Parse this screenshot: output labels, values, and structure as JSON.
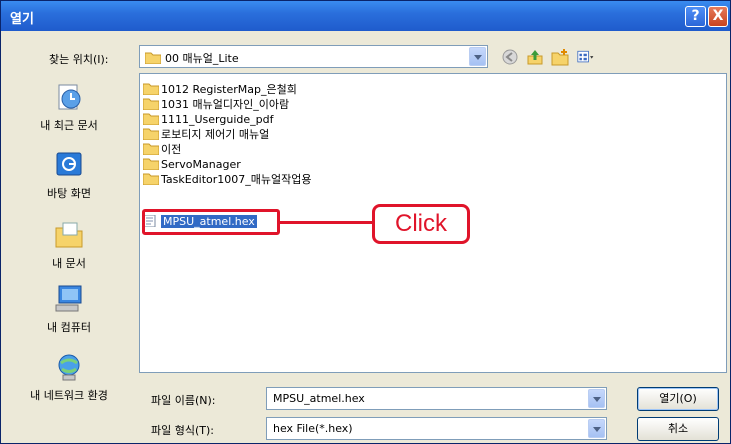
{
  "window": {
    "title": "열기",
    "help_glyph": "?",
    "close_glyph": "X"
  },
  "lookin": {
    "label": "찾는 위치(I):",
    "value": "00 매뉴얼_Lite"
  },
  "toolbar_icons": [
    "back-icon",
    "up-folder-icon",
    "new-folder-icon",
    "view-menu-icon"
  ],
  "places": [
    {
      "label": "내 최근 문서",
      "icon": "recent-documents-icon"
    },
    {
      "label": "바탕 화면",
      "icon": "desktop-icon"
    },
    {
      "label": "내 문서",
      "icon": "my-documents-icon"
    },
    {
      "label": "내 컴퓨터",
      "icon": "my-computer-icon"
    },
    {
      "label": "내 네트워크 환경",
      "icon": "network-icon"
    }
  ],
  "files": [
    {
      "name": "1012 RegisterMap_은철희",
      "type": "folder"
    },
    {
      "name": "1031 매뉴얼디자인_이아람",
      "type": "folder"
    },
    {
      "name": "1111_Userguide_pdf",
      "type": "folder"
    },
    {
      "name": "로보티지 제어기 매뉴얼",
      "type": "folder"
    },
    {
      "name": "이전",
      "type": "folder"
    },
    {
      "name": "ServoManager",
      "type": "folder"
    },
    {
      "name": "TaskEditor1007_매뉴얼작업용",
      "type": "folder"
    },
    {
      "name": "MPSU_atmel.hex",
      "type": "file",
      "selected": true
    }
  ],
  "callout": {
    "label": "Click",
    "color": "#e0142a"
  },
  "filename": {
    "label": "파일 이름(N):",
    "value": "MPSU_atmel.hex"
  },
  "filetype": {
    "label": "파일 형식(T):",
    "value": "hex File(*.hex)"
  },
  "buttons": {
    "open": "열기(O)",
    "cancel": "취소"
  },
  "colors": {
    "titlebar": "#2a6fdc",
    "selection": "#316ac5",
    "dialog_bg": "#ece9d8"
  }
}
